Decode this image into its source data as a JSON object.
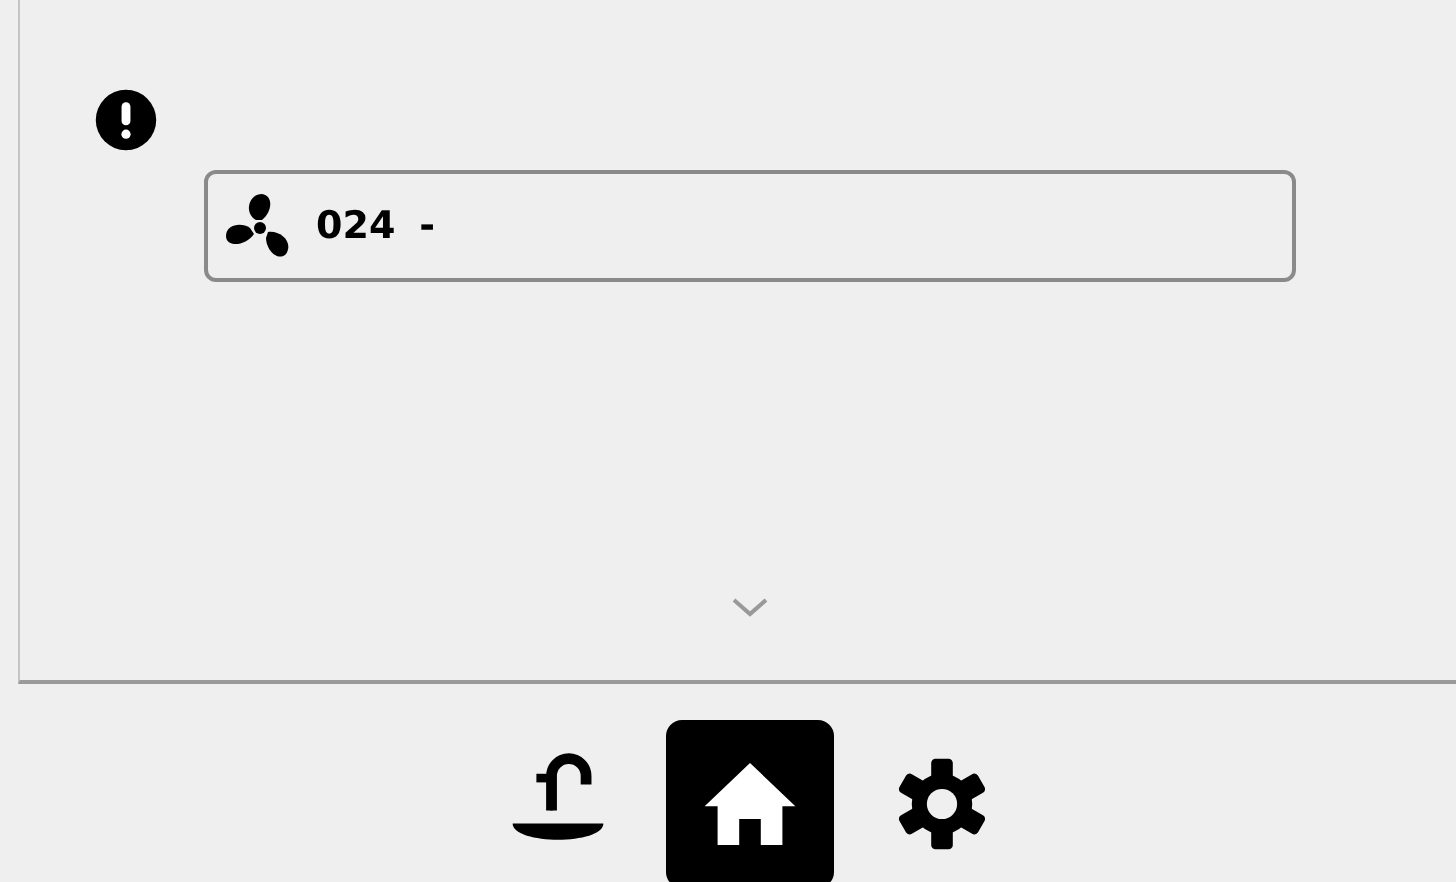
{
  "fan_entry": {
    "code": "024",
    "value": "-"
  },
  "nav": [
    {
      "kind": "water",
      "selected": false
    },
    {
      "kind": "home",
      "selected": true
    },
    {
      "kind": "settings",
      "selected": false
    }
  ]
}
